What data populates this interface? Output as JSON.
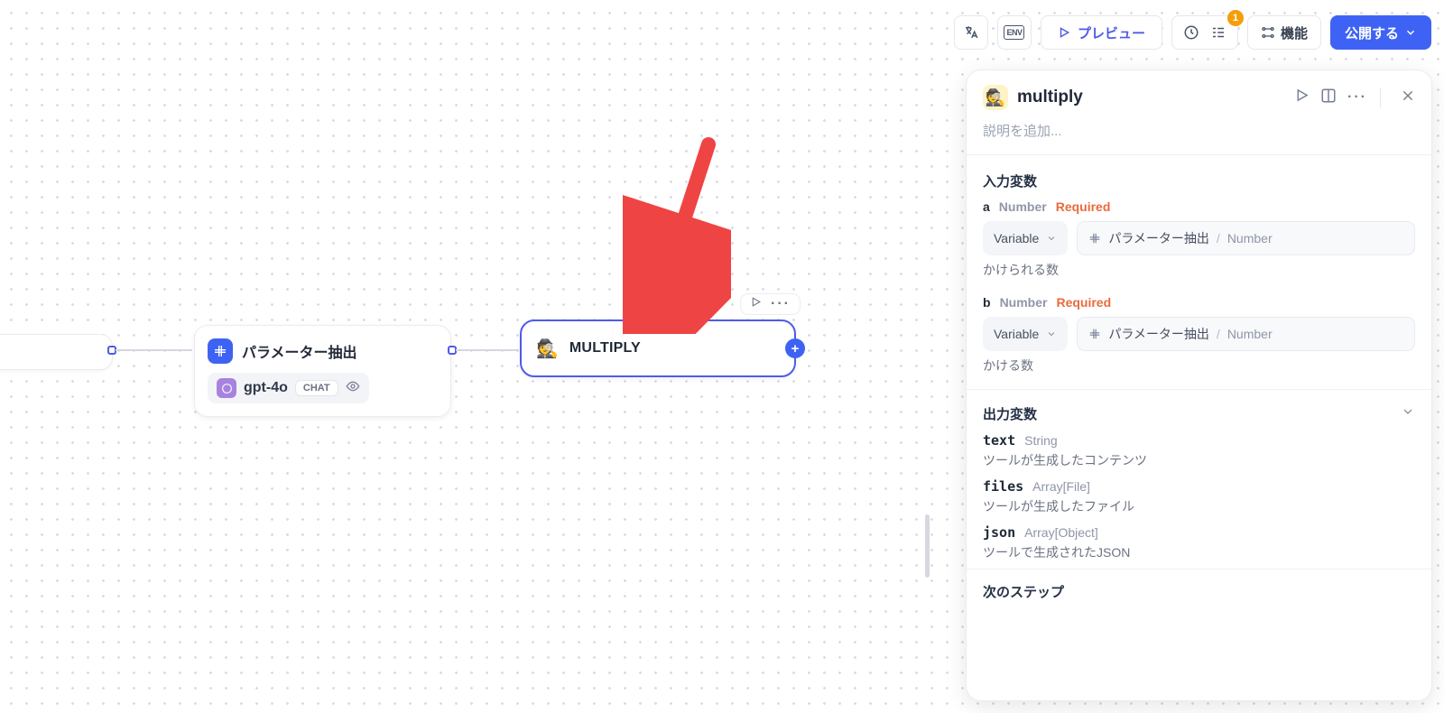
{
  "topbar": {
    "preview": "プレビュー",
    "features": "機能",
    "publish": "公開する",
    "env_label": "ENV",
    "badge": "1"
  },
  "nodes": {
    "param": {
      "title": "パラメーター抽出",
      "model": "gpt-4o",
      "chat_tag": "CHAT"
    },
    "multiply": {
      "title": "MULTIPLY"
    }
  },
  "panel": {
    "title": "multiply",
    "description_placeholder": "説明を追加...",
    "inputs_title": "入力変数",
    "outputs_title": "出力変数",
    "next_title": "次のステップ",
    "variable_label": "Variable",
    "required_label": "Required",
    "inputs": {
      "a": {
        "name": "a",
        "type": "Number",
        "src": "パラメーター抽出",
        "value_type": "Number",
        "help": "かけられる数"
      },
      "b": {
        "name": "b",
        "type": "Number",
        "src": "パラメーター抽出",
        "value_type": "Number",
        "help": "かける数"
      }
    },
    "outputs": {
      "text": {
        "name": "text",
        "type": "String",
        "desc": "ツールが生成したコンテンツ"
      },
      "files": {
        "name": "files",
        "type": "Array[File]",
        "desc": "ツールが生成したファイル"
      },
      "json": {
        "name": "json",
        "type": "Array[Object]",
        "desc": "ツールで生成されたJSON"
      }
    }
  }
}
